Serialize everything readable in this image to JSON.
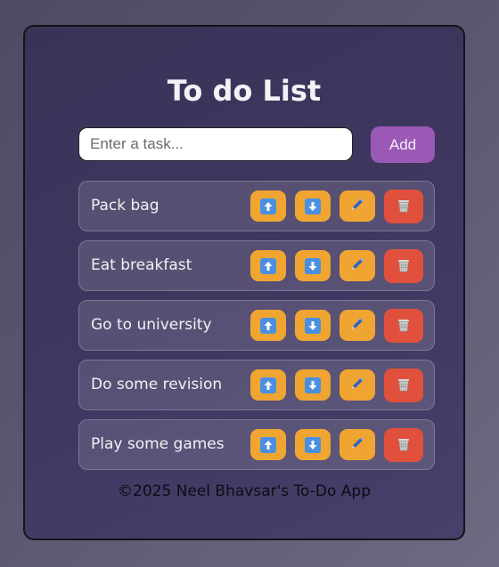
{
  "app": {
    "title": "To do List",
    "input_placeholder": "Enter a task...",
    "add_label": "Add",
    "footer": "©2025 Neel Bhavsar's To-Do App"
  },
  "tasks": [
    {
      "text": "Pack bag"
    },
    {
      "text": "Eat breakfast"
    },
    {
      "text": "Go to university"
    },
    {
      "text": "Do some revision"
    },
    {
      "text": "Play some games"
    }
  ],
  "task_buttons": {
    "move_up_icon": "arrow-up-icon",
    "move_down_icon": "arrow-down-icon",
    "edit_icon": "pencil-icon",
    "delete_icon": "wastebasket-icon"
  },
  "colors": {
    "add_button": "#9b59b6",
    "action_button": "#f0a532",
    "delete_button": "#e0503c",
    "card_background": "#3f3760"
  }
}
